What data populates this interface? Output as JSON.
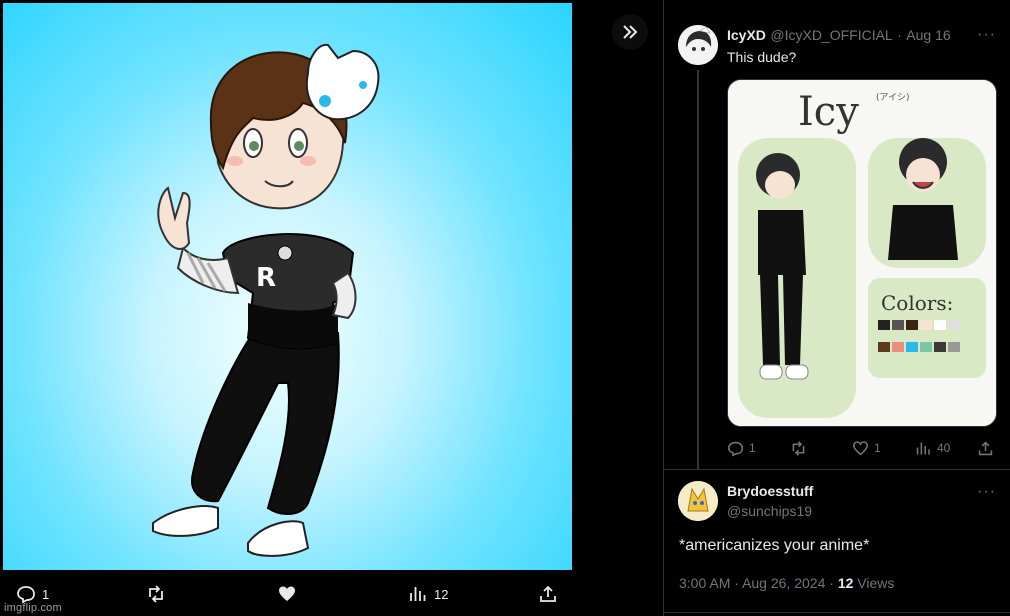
{
  "media_actions": {
    "replies": "1",
    "likes_count": "",
    "views": "12"
  },
  "watermark": "imgflip.com",
  "parent_tweet": {
    "name": "IcyXD",
    "handle": "@IcyXD_OFFICIAL",
    "separator": "·",
    "date": "Aug 16",
    "text": "This dude?",
    "actions": {
      "replies": "1",
      "likes": "1",
      "views": "40"
    },
    "image_text": {
      "title": "Icy",
      "furigana": "(アイシ)",
      "colors_label": "Colors:"
    }
  },
  "reply_tweet": {
    "name": "Brydoesstuff",
    "handle": "@sunchips19",
    "text": "*americanizes your anime*",
    "time": "3:00 AM",
    "separator": "·",
    "date": "Aug 26, 2024",
    "views_count": "12",
    "views_label": "Views"
  },
  "colors": {
    "background": "#000000",
    "art_background": "#2ad4ff",
    "text_primary": "#e7e9ea",
    "text_muted": "#71767b",
    "divider": "#2f3336"
  },
  "icons": [
    "collapse-icon",
    "reply-icon",
    "retweet-icon",
    "like-icon",
    "views-icon",
    "share-icon",
    "more-icon"
  ]
}
